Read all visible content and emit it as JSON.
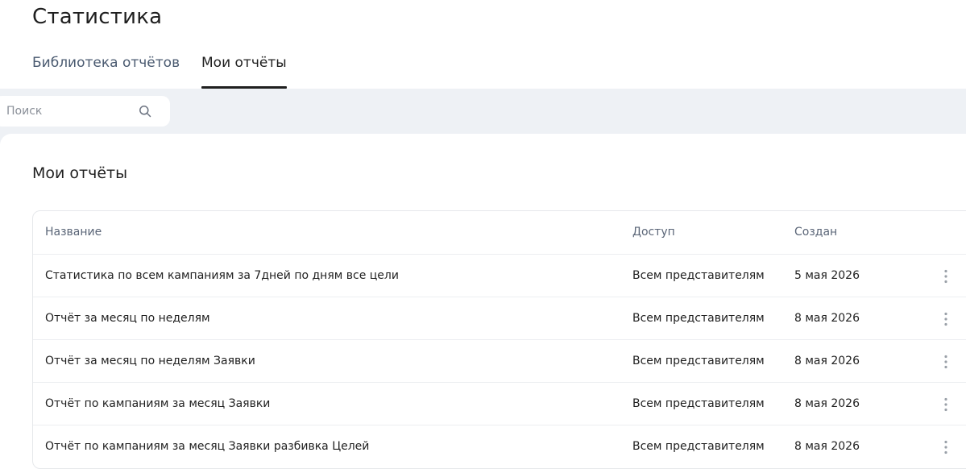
{
  "page": {
    "title": "Статистика"
  },
  "tabs": [
    {
      "label": "Библиотека отчётов",
      "active": false
    },
    {
      "label": "Мои отчёты",
      "active": true
    }
  ],
  "search": {
    "placeholder": "Поиск",
    "value": "",
    "icon": "search-icon"
  },
  "section": {
    "title": "Мои отчёты"
  },
  "table": {
    "columns": {
      "name": "Название",
      "access": "Доступ",
      "created": "Создан"
    },
    "rows": [
      {
        "name": "Статистика по всем кампаниям за 7дней по дням все цели",
        "access": "Всем представителям",
        "created": "5 мая 2026"
      },
      {
        "name": "Отчёт за месяц по неделям",
        "access": "Всем представителям",
        "created": "8 мая 2026"
      },
      {
        "name": "Отчёт за месяц по неделям Заявки",
        "access": "Всем представителям",
        "created": "8 мая 2026"
      },
      {
        "name": "Отчёт по кампаниям за месяц Заявки",
        "access": "Всем представителям",
        "created": "8 мая 2026"
      },
      {
        "name": "Отчёт по кампаниям за месяц Заявки разбивка Целей",
        "access": "Всем представителям",
        "created": "8 мая 2026"
      }
    ],
    "row_menu_icon": "more-vertical-icon"
  },
  "colors": {
    "background": "#ffffff",
    "band": "#eef1f5",
    "text": "#1f1f1f",
    "muted": "#5a6577",
    "tab_inactive": "#4a5a70",
    "border": "#e6e8eb"
  }
}
